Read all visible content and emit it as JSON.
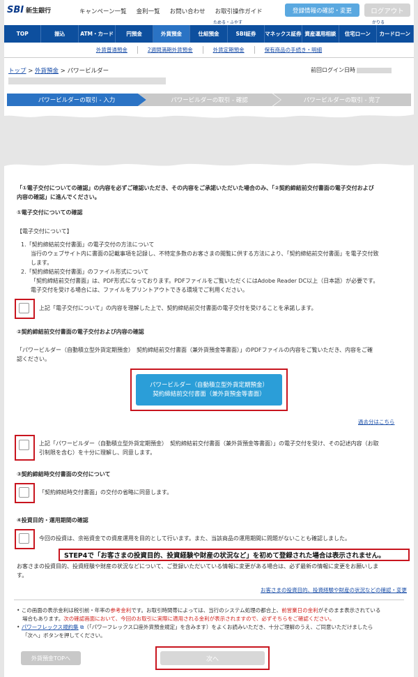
{
  "header": {
    "logo_sbi": "SBI",
    "logo_bank": "新生銀行",
    "links": [
      "キャンペーン一覧",
      "金利一覧",
      "お問い合わせ",
      "お取引操作ガイド"
    ],
    "register_button": "登録情報の確認・変更",
    "logout_button": "ログアウト"
  },
  "nav": {
    "group_save": "ためる・ふやす",
    "group_borrow": "かりる",
    "items": [
      "TOP",
      "振込",
      "ATM・カード",
      "円預金",
      "外貨預金",
      "仕組預金",
      "SBI証券",
      "マネックス証券",
      "資産運用相談",
      "住宅ローン",
      "カードローン"
    ],
    "active_index": 4,
    "subitems": [
      "外貨普通預金",
      "2週間満期外貨預金",
      "外貨定期預金",
      "保有商品の手続き・明細"
    ]
  },
  "breadcrumb": {
    "top": "トップ",
    "fx": "外貨預金",
    "current": "パワービルダー",
    "sep": " > ",
    "last_login": "前回ログイン日時"
  },
  "steps": [
    "パワービルダーの取引 - 入力",
    "パワービルダーの取引 - 確認",
    "パワービルダーの取引 - 完了"
  ],
  "content": {
    "intro_1": "「①電子交付についての確認」の内容を必ずご確認いただき、その内容をご承諾いただいた場合のみ、「②契約締結前交付書面の電子交付および",
    "intro_2": "内容の確認」に進んでください。",
    "s1_title": "①電子交付についての確認",
    "s1_sub": "【電子交付について】",
    "s1_l1": "1.「契約締結前交付書面」の電子交付の方法について",
    "s1_l2": "当行のウェブサイト内に書面の記載事項を記録し、不特定多数のお客さまの閲覧に供する方法により、「契約締結前交付書面」を電子交付致",
    "s1_l3": "します。",
    "s1_l4": "2.「契約締結前交付書面」のファイル形式について",
    "s1_l5": "「契約締結前交付書面」は、PDF形式になっております。PDFファイルをご覧いただくにはAdobe Reader DC以上（日本語）が必要です。",
    "s1_l6": "電子交付を受ける場合には、ファイルをプリントアウトできる環境でご利用ください。",
    "cb1": "上記「電子交付について」の内容を理解した上で、契約締結前交付書面の電子交付を受けることを承諾します。",
    "s2_title": "②契約締結前交付書面の電子交付および内容の確認",
    "s2_l1": "「パワービルダー（自動積立型外貨定期預金）　契約締結前交付書面（兼外貨預金等書面）」のPDFファイルの内容をご覧いただき、内容をご確",
    "s2_l2": "認ください。",
    "pdf_l1": "パワービルダー（自動積立型外貨定期預金）",
    "pdf_l2": "契約締結前交付書面（兼外貨預金等書面）",
    "past": "過去分はこちら",
    "cb2_l1": "上記「パワービルダー（自動積立型外貨定期預金）　契約締結前交付書面（兼外貨預金等書面）」の電子交付を受け、その記述内容（お取",
    "cb2_l2": "引制限を含む）を十分に理解し、同意します。",
    "s3_title": "③契約締結時交付書面の交付について",
    "cb3": "「契約締結時交付書面」の交付の省略に同意します。",
    "s4_title": "④投資目的・運用期間の確認",
    "cb4": "今回の投資は、余裕資金での資産運用を目的として行います。また、当該商品の運用期間に問題がないことも確認しました。",
    "callout": "STEP4で「お客さまの投資目的、投資経験や財産の状況など」を初めて登録された場合は表示されません。",
    "s4_l1": "お客さまの投資目的、投資経験や財産の状況などについて、ご登録いただいている情報に変更がある場合は、必ず最新の情報に変更をお願いしま",
    "s4_l2": "す。",
    "s4_link": "お客さまの投資目的、投資経験や財産の状況などの確認・変更",
    "n1_a": "この画面の表示金利は税引前・年率の",
    "n1_b": "参考金利",
    "n1_c": "です。お取引時間帯によっては、当行のシステム処理の都合上、",
    "n1_d": "前営業日の金利",
    "n1_e": "がそのまま表示されている",
    "n2_a": "場合もあります。",
    "n2_b": "次の確認画面において、今回のお取引に実際に適用される金利が表示されますので、必ずそちらをご確認ください。",
    "n3_link": "パワーフレックス規約集",
    "n3_b": "（「パワーフレックス口座外貨預金規定」を含みます）をよくお読みいただき、十分ご理解のうえ、ご同意いただけましたら",
    "n4": "「次へ」ボタンを押してください。"
  },
  "buttons": {
    "back": "外貨預金TOPへ",
    "next": "次へ"
  }
}
